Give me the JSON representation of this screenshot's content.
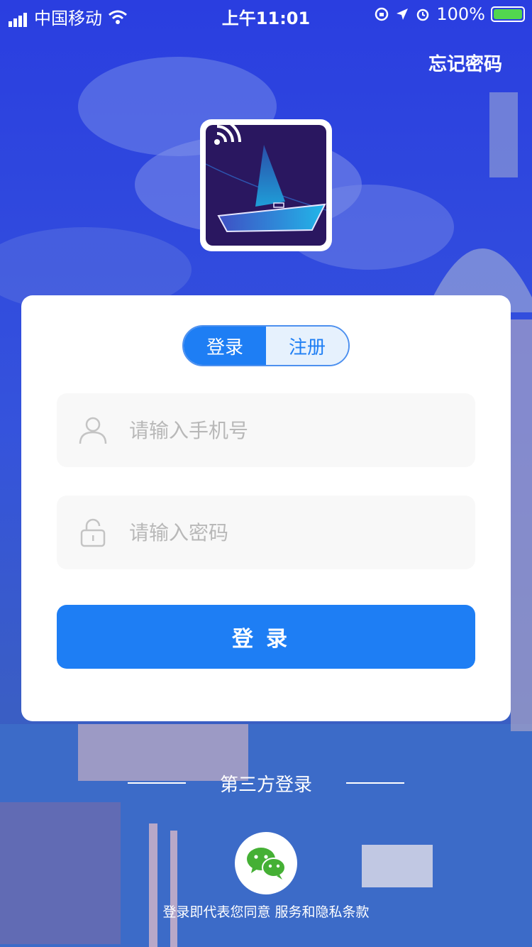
{
  "status": {
    "carrier": "中国移动",
    "time": "上午11:01",
    "battery": "100%"
  },
  "header": {
    "forgot_password": "忘记密码"
  },
  "tabs": {
    "login": "登录",
    "register": "注册"
  },
  "form": {
    "phone_placeholder": "请输入手机号",
    "password_placeholder": "请输入密码",
    "login_button": "登录"
  },
  "third_party": {
    "label": "第三方登录"
  },
  "footer": {
    "terms": "登录即代表您同意 服务和隐私条款"
  },
  "colors": {
    "primary": "#1e7ef4",
    "background": "#3450d8"
  },
  "icons": [
    "signal-icon",
    "wifi-icon",
    "lock-rotation-icon",
    "location-icon",
    "alarm-icon",
    "battery-icon",
    "user-icon",
    "lock-icon",
    "wechat-icon",
    "sailboat-logo-icon"
  ]
}
